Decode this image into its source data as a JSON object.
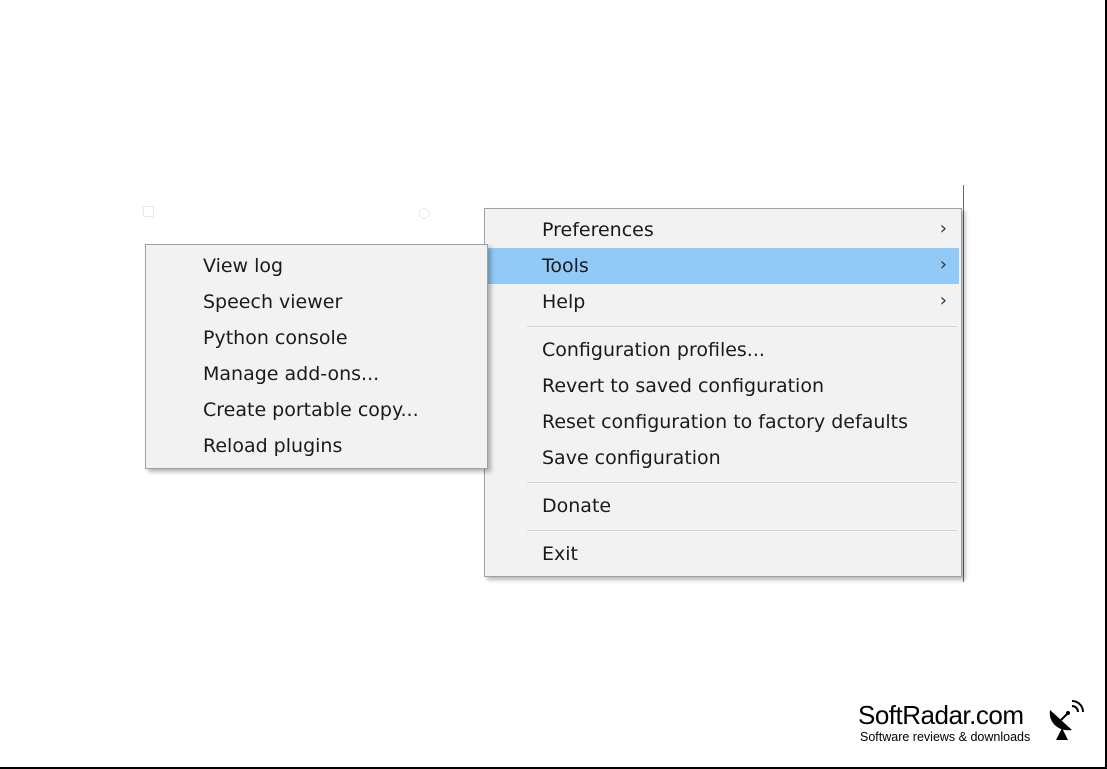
{
  "main_menu": {
    "items": [
      {
        "label": "Preferences",
        "has_submenu": true,
        "highlighted": false
      },
      {
        "label": "Tools",
        "has_submenu": true,
        "highlighted": true
      },
      {
        "label": "Help",
        "has_submenu": true,
        "highlighted": false
      },
      {
        "label": "Configuration profiles...",
        "has_submenu": false
      },
      {
        "label": "Revert to saved configuration",
        "has_submenu": false
      },
      {
        "label": "Reset configuration to factory defaults",
        "has_submenu": false
      },
      {
        "label": "Save configuration",
        "has_submenu": false
      },
      {
        "label": "Donate",
        "has_submenu": false
      },
      {
        "label": "Exit",
        "has_submenu": false
      }
    ],
    "submenu_glyph": "›",
    "highlight_color": "#91c9f7"
  },
  "tools_submenu": {
    "items": [
      {
        "label": "View log"
      },
      {
        "label": "Speech viewer"
      },
      {
        "label": "Python console"
      },
      {
        "label": "Manage add-ons..."
      },
      {
        "label": "Create portable copy..."
      },
      {
        "label": "Reload plugins"
      }
    ]
  },
  "watermark": {
    "brand": "SoftRadar.com",
    "tagline": "Software reviews & downloads",
    "icon": "satellite-dish-icon"
  }
}
